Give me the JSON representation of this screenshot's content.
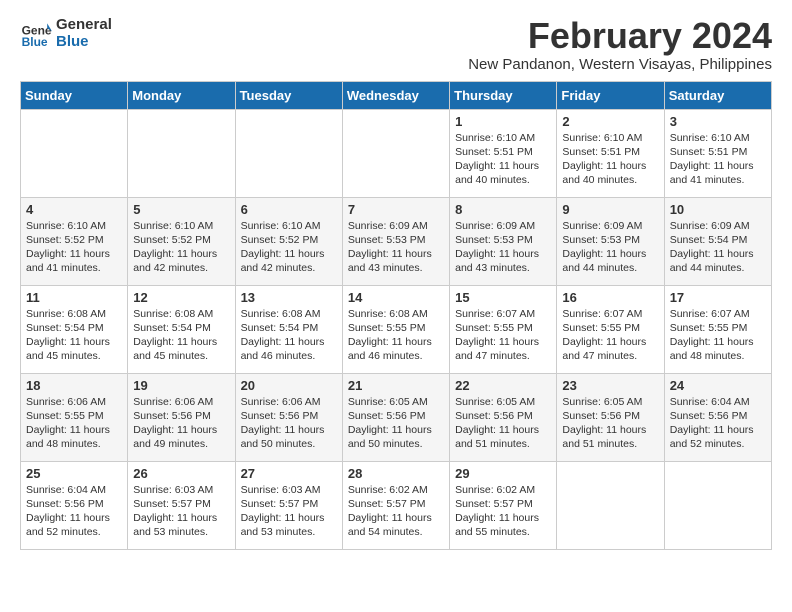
{
  "logo": {
    "line1": "General",
    "line2": "Blue"
  },
  "title": "February 2024",
  "subtitle": "New Pandanon, Western Visayas, Philippines",
  "days_of_week": [
    "Sunday",
    "Monday",
    "Tuesday",
    "Wednesday",
    "Thursday",
    "Friday",
    "Saturday"
  ],
  "weeks": [
    [
      {
        "day": "",
        "info": ""
      },
      {
        "day": "",
        "info": ""
      },
      {
        "day": "",
        "info": ""
      },
      {
        "day": "",
        "info": ""
      },
      {
        "day": "1",
        "info": "Sunrise: 6:10 AM\nSunset: 5:51 PM\nDaylight: 11 hours\nand 40 minutes."
      },
      {
        "day": "2",
        "info": "Sunrise: 6:10 AM\nSunset: 5:51 PM\nDaylight: 11 hours\nand 40 minutes."
      },
      {
        "day": "3",
        "info": "Sunrise: 6:10 AM\nSunset: 5:51 PM\nDaylight: 11 hours\nand 41 minutes."
      }
    ],
    [
      {
        "day": "4",
        "info": "Sunrise: 6:10 AM\nSunset: 5:52 PM\nDaylight: 11 hours\nand 41 minutes."
      },
      {
        "day": "5",
        "info": "Sunrise: 6:10 AM\nSunset: 5:52 PM\nDaylight: 11 hours\nand 42 minutes."
      },
      {
        "day": "6",
        "info": "Sunrise: 6:10 AM\nSunset: 5:52 PM\nDaylight: 11 hours\nand 42 minutes."
      },
      {
        "day": "7",
        "info": "Sunrise: 6:09 AM\nSunset: 5:53 PM\nDaylight: 11 hours\nand 43 minutes."
      },
      {
        "day": "8",
        "info": "Sunrise: 6:09 AM\nSunset: 5:53 PM\nDaylight: 11 hours\nand 43 minutes."
      },
      {
        "day": "9",
        "info": "Sunrise: 6:09 AM\nSunset: 5:53 PM\nDaylight: 11 hours\nand 44 minutes."
      },
      {
        "day": "10",
        "info": "Sunrise: 6:09 AM\nSunset: 5:54 PM\nDaylight: 11 hours\nand 44 minutes."
      }
    ],
    [
      {
        "day": "11",
        "info": "Sunrise: 6:08 AM\nSunset: 5:54 PM\nDaylight: 11 hours\nand 45 minutes."
      },
      {
        "day": "12",
        "info": "Sunrise: 6:08 AM\nSunset: 5:54 PM\nDaylight: 11 hours\nand 45 minutes."
      },
      {
        "day": "13",
        "info": "Sunrise: 6:08 AM\nSunset: 5:54 PM\nDaylight: 11 hours\nand 46 minutes."
      },
      {
        "day": "14",
        "info": "Sunrise: 6:08 AM\nSunset: 5:55 PM\nDaylight: 11 hours\nand 46 minutes."
      },
      {
        "day": "15",
        "info": "Sunrise: 6:07 AM\nSunset: 5:55 PM\nDaylight: 11 hours\nand 47 minutes."
      },
      {
        "day": "16",
        "info": "Sunrise: 6:07 AM\nSunset: 5:55 PM\nDaylight: 11 hours\nand 47 minutes."
      },
      {
        "day": "17",
        "info": "Sunrise: 6:07 AM\nSunset: 5:55 PM\nDaylight: 11 hours\nand 48 minutes."
      }
    ],
    [
      {
        "day": "18",
        "info": "Sunrise: 6:06 AM\nSunset: 5:55 PM\nDaylight: 11 hours\nand 48 minutes."
      },
      {
        "day": "19",
        "info": "Sunrise: 6:06 AM\nSunset: 5:56 PM\nDaylight: 11 hours\nand 49 minutes."
      },
      {
        "day": "20",
        "info": "Sunrise: 6:06 AM\nSunset: 5:56 PM\nDaylight: 11 hours\nand 50 minutes."
      },
      {
        "day": "21",
        "info": "Sunrise: 6:05 AM\nSunset: 5:56 PM\nDaylight: 11 hours\nand 50 minutes."
      },
      {
        "day": "22",
        "info": "Sunrise: 6:05 AM\nSunset: 5:56 PM\nDaylight: 11 hours\nand 51 minutes."
      },
      {
        "day": "23",
        "info": "Sunrise: 6:05 AM\nSunset: 5:56 PM\nDaylight: 11 hours\nand 51 minutes."
      },
      {
        "day": "24",
        "info": "Sunrise: 6:04 AM\nSunset: 5:56 PM\nDaylight: 11 hours\nand 52 minutes."
      }
    ],
    [
      {
        "day": "25",
        "info": "Sunrise: 6:04 AM\nSunset: 5:56 PM\nDaylight: 11 hours\nand 52 minutes."
      },
      {
        "day": "26",
        "info": "Sunrise: 6:03 AM\nSunset: 5:57 PM\nDaylight: 11 hours\nand 53 minutes."
      },
      {
        "day": "27",
        "info": "Sunrise: 6:03 AM\nSunset: 5:57 PM\nDaylight: 11 hours\nand 53 minutes."
      },
      {
        "day": "28",
        "info": "Sunrise: 6:02 AM\nSunset: 5:57 PM\nDaylight: 11 hours\nand 54 minutes."
      },
      {
        "day": "29",
        "info": "Sunrise: 6:02 AM\nSunset: 5:57 PM\nDaylight: 11 hours\nand 55 minutes."
      },
      {
        "day": "",
        "info": ""
      },
      {
        "day": "",
        "info": ""
      }
    ]
  ]
}
